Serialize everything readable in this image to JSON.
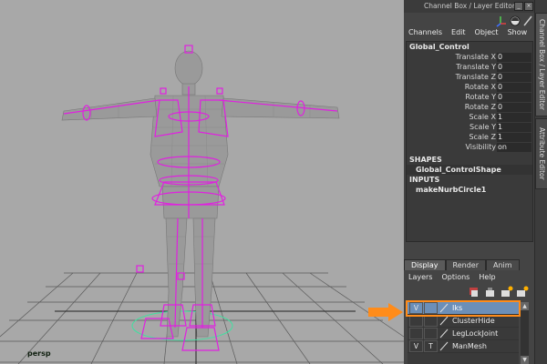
{
  "viewport": {
    "camera_label": "persp"
  },
  "panel": {
    "title": "Channel Box / Layer Editor",
    "side_tabs": {
      "channel_box_layer_editor": "Channel Box / Layer Editor",
      "attribute_editor": "Attribute Editor"
    },
    "menu": [
      "Channels",
      "Edit",
      "Object",
      "Show"
    ],
    "node_name": "Global_Control",
    "attributes": [
      {
        "label": "Translate X",
        "value": "0"
      },
      {
        "label": "Translate Y",
        "value": "0"
      },
      {
        "label": "Translate Z",
        "value": "0"
      },
      {
        "label": "Rotate X",
        "value": "0"
      },
      {
        "label": "Rotate Y",
        "value": "0"
      },
      {
        "label": "Rotate Z",
        "value": "0"
      },
      {
        "label": "Scale X",
        "value": "1"
      },
      {
        "label": "Scale Y",
        "value": "1"
      },
      {
        "label": "Scale Z",
        "value": "1"
      },
      {
        "label": "Visibility",
        "value": "on"
      }
    ],
    "shapes_title": "SHAPES",
    "shape_node": "Global_ControlShape",
    "inputs_title": "INPUTS",
    "input_node": "makeNurbCircle1"
  },
  "layer_editor": {
    "tabs": [
      "Display",
      "Render",
      "Anim"
    ],
    "active_tab": "Display",
    "menu": [
      "Layers",
      "Options",
      "Help"
    ],
    "layers": [
      {
        "v": "V",
        "t": "",
        "name": "Iks",
        "selected": true
      },
      {
        "v": "",
        "t": "",
        "name": "ClusterHide",
        "selected": false
      },
      {
        "v": "",
        "t": "",
        "name": "LegLockJoint",
        "selected": false
      },
      {
        "v": "V",
        "t": "T",
        "name": "ManMesh",
        "selected": false
      }
    ]
  },
  "colors": {
    "highlight_arrow": "#ff8c1a",
    "selected_layer": "#6c8fb8",
    "rig_magenta": "#e020e0"
  }
}
